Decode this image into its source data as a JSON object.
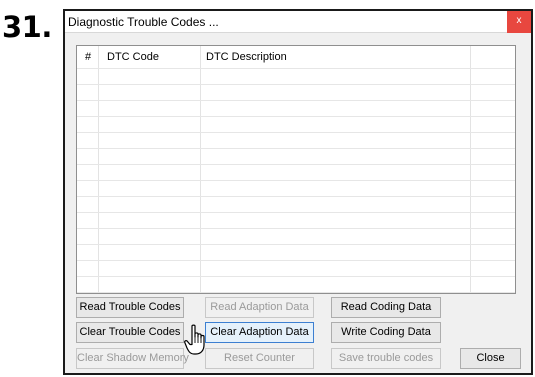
{
  "step": "31.",
  "window": {
    "title": "Diagnostic Trouble Codes ...",
    "close_glyph": "x"
  },
  "table": {
    "columns": [
      "#",
      "DTC Code",
      "DTC Description"
    ],
    "rows": []
  },
  "buttons": {
    "read_trouble_codes": "Read Trouble Codes",
    "read_adaption_data": "Read Adaption Data",
    "read_coding_data": "Read Coding Data",
    "clear_trouble_codes": "Clear Trouble Codes",
    "clear_adaption_data": "Clear Adaption Data",
    "write_coding_data": "Write Coding Data",
    "clear_shadow_memory": "Clear Shadow Memory",
    "reset_counter": "Reset Counter",
    "save_trouble_codes": "Save trouble codes",
    "close": "Close"
  },
  "icons": {
    "cursor": "hand-pointer-icon"
  }
}
